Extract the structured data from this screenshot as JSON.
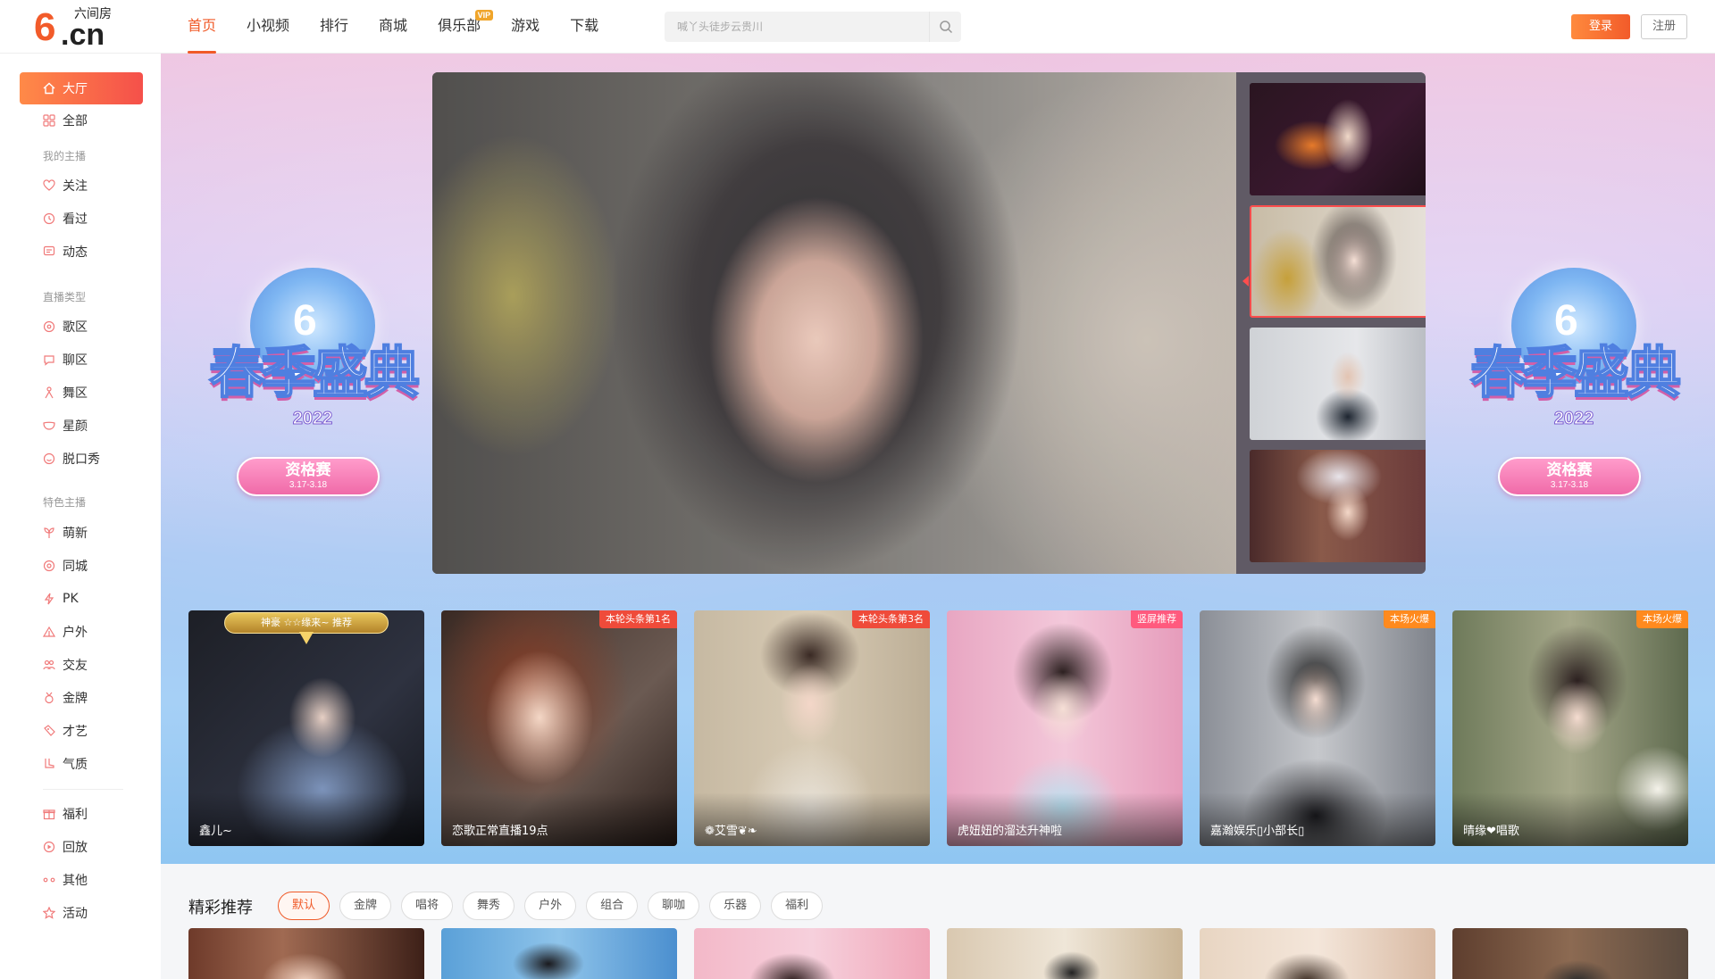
{
  "brand": {
    "name": "六间房",
    "mark": "6",
    "domain": ".cn",
    "accent": "#f05a28"
  },
  "header": {
    "nav": [
      {
        "label": "首页",
        "active": true
      },
      {
        "label": "小视频"
      },
      {
        "label": "排行"
      },
      {
        "label": "商城"
      },
      {
        "label": "俱乐部",
        "badge": "VIP"
      },
      {
        "label": "游戏"
      },
      {
        "label": "下载"
      }
    ],
    "search": {
      "placeholder": "喊丫头徒步云贵川",
      "icon": "search-icon"
    },
    "login_label": "登录",
    "register_label": "注册"
  },
  "sidebar": {
    "top": [
      {
        "label": "大厅",
        "icon": "home-icon",
        "active": true
      },
      {
        "label": "全部",
        "icon": "grid-icon"
      }
    ],
    "groups": [
      {
        "title": "我的主播",
        "items": [
          {
            "label": "关注",
            "icon": "heart-icon"
          },
          {
            "label": "看过",
            "icon": "clock-icon"
          },
          {
            "label": "动态",
            "icon": "message-icon"
          }
        ]
      },
      {
        "title": "直播类型",
        "items": [
          {
            "label": "歌区",
            "icon": "music-icon"
          },
          {
            "label": "聊区",
            "icon": "chat-icon"
          },
          {
            "label": "舞区",
            "icon": "dance-icon"
          },
          {
            "label": "星颜",
            "icon": "mask-icon"
          },
          {
            "label": "脱口秀",
            "icon": "smile-icon"
          }
        ]
      },
      {
        "title": "特色主播",
        "items": [
          {
            "label": "萌新",
            "icon": "sprout-icon"
          },
          {
            "label": "同城",
            "icon": "location-icon"
          },
          {
            "label": "PK",
            "icon": "lightning-icon"
          },
          {
            "label": "户外",
            "icon": "tent-icon"
          },
          {
            "label": "交友",
            "icon": "people-icon"
          },
          {
            "label": "金牌",
            "icon": "medal-icon"
          },
          {
            "label": "才艺",
            "icon": "palette-icon"
          },
          {
            "label": "气质",
            "icon": "boot-icon"
          }
        ]
      },
      {
        "title": "",
        "items": [
          {
            "label": "福利",
            "icon": "gift-icon"
          },
          {
            "label": "回放",
            "icon": "replay-icon"
          },
          {
            "label": "其他",
            "icon": "more-icon"
          },
          {
            "label": "活动",
            "icon": "star-icon"
          }
        ]
      }
    ]
  },
  "hero": {
    "event": {
      "title": "春季盛典",
      "year": "2022",
      "stage": "资格赛",
      "dates": "3.17-3.18"
    },
    "thumbnails_count": 4,
    "active_thumbnail": 2
  },
  "recommended_cards": [
    {
      "name": "鑫儿~",
      "crown": "神豪 ☆☆缘来~ 推荐"
    },
    {
      "name": "恋歌正常直播19点",
      "tag": "本轮头条第1名",
      "tag_color": "#ef4b3a"
    },
    {
      "name": "❁艾雪❦❧",
      "tag": "本轮头条第3名",
      "tag_color": "#ef4b3a"
    },
    {
      "name": "虎妞妞的溜达升神啦",
      "tag": "竖屏推荐",
      "tag_color": "#ff5a7e"
    },
    {
      "name": "嘉瀚娱乐▯小部长▯",
      "tag": "本场火爆",
      "tag_color": "#ff8a1e"
    },
    {
      "name": "晴缘❤唱歌",
      "tag": "本场火爆",
      "tag_color": "#ff8a1e"
    }
  ],
  "featured": {
    "title": "精彩推荐",
    "filters": [
      {
        "label": "默认",
        "active": true
      },
      {
        "label": "金牌"
      },
      {
        "label": "唱将"
      },
      {
        "label": "舞秀"
      },
      {
        "label": "户外"
      },
      {
        "label": "组合"
      },
      {
        "label": "聊咖"
      },
      {
        "label": "乐器"
      },
      {
        "label": "福利"
      }
    ]
  }
}
